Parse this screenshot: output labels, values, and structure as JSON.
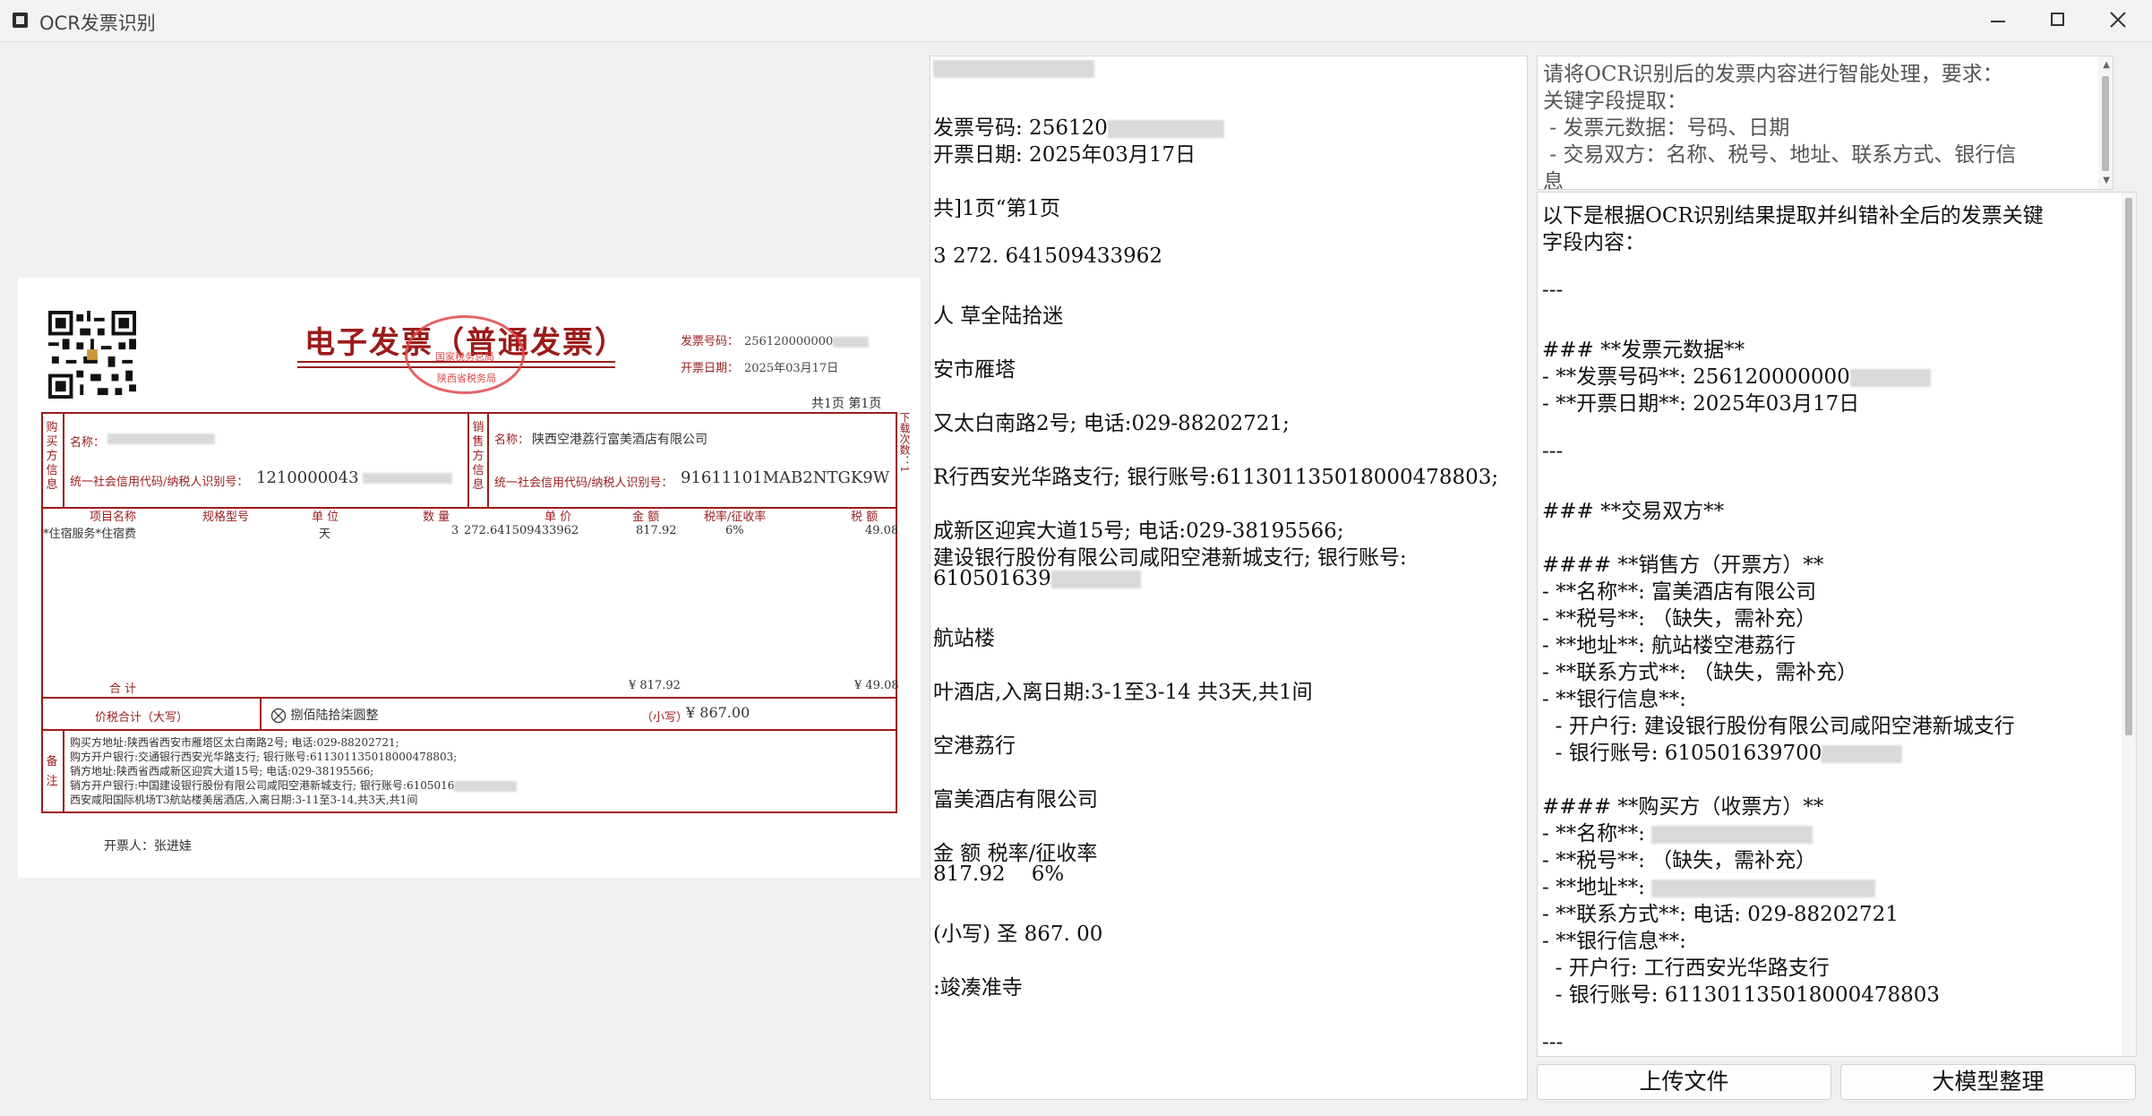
{
  "window": {
    "title": "OCR发票识别",
    "min_icon": "minimize-icon",
    "max_icon": "maximize-icon",
    "close_icon": "close-icon"
  },
  "invoice": {
    "title": "电子发票（普通发票）",
    "seal_top": "国家税务总局",
    "seal_bottom": "陕西省税务局",
    "invoice_no_label": "发票号码：",
    "invoice_no": "256120000000",
    "date_label": "开票日期：",
    "date": "2025年03月17日",
    "pages": "共1页    第1页",
    "side_note": "下载次数：1",
    "buyer_vlabel": "购买方信息",
    "seller_vlabel": "销售方信息",
    "name_label": "名称：",
    "buyer_name": "",
    "seller_name": "陕西空港荔行富美酒店有限公司",
    "tax_label": "统一社会信用代码/纳税人识别号：",
    "buyer_tax": "1210000043",
    "seller_tax": "91611101MAB2NTGK9W",
    "columns": [
      "项目名称",
      "规格型号",
      "单  位",
      "数  量",
      "单  价",
      "金  额",
      "税率/征收率",
      "税  额"
    ],
    "item": {
      "name": "*住宿服务*住宿费",
      "spec": "",
      "unit": "天",
      "qty": "3",
      "price": "272.641509433962",
      "amount": "817.92",
      "rate": "6%",
      "tax": "49.08"
    },
    "total_label": "合        计",
    "total_amount": "¥ 817.92",
    "total_tax": "¥ 49.08",
    "price_tax_label": "价税合计（大写）",
    "amount_words": "捌佰陆拾柒圆整",
    "small_label": "（小写）",
    "amount_small": "¥  867.00",
    "remark_vlabel": "备注",
    "remarks": [
      "购买方地址:陕西省西安市雁塔区太白南路2号;  电话:029-88202721;",
      "购方开户银行:交通银行西安光华路支行;  银行账号:611301135018000478803;",
      "销方地址:陕西省西咸新区迎宾大道15号;  电话:029-38195566;",
      "销方开户银行:中国建设银行股份有限公司咸阳空港新城支行;  银行账号:6105016",
      "西安咸阳国际机场T3航站楼美居酒店,入离日期:3-11至3-14,共3天,共1间"
    ],
    "drawer": "开票人：张进娃"
  },
  "ocr_text": [
    "",
    "发票号码: 256120",
    "开票日期: 2025年03月17日",
    "",
    "共]1页“第1页",
    "",
    "3 272. 641509433962",
    "",
    "人 草全陆拾迷",
    "",
    "安市雁塔",
    "",
    "又太白南路2号; 电话:029-88202721;",
    "",
    "R行西安光华路支行; 银行账号:611301135018000478803;",
    "",
    "成新区迎宾大道15号; 电话:029-38195566;",
    "建设银行股份有限公司咸阳空港新城支行; 银行账号:",
    "610501639",
    "",
    "航站楼",
    "",
    "叶酒店,入离日期:3-1至3-14 共3天,共1间",
    "",
    "空港荔行",
    "",
    "富美酒店有限公司",
    "",
    "金 额 税率/征收率",
    "817.92    6%",
    "",
    "(小写) 圣 867. 00",
    "",
    ":竣凑准寺"
  ],
  "prompt_text": [
    "请将OCR识别后的发票内容进行智能处理，要求：",
    "关键字段提取：",
    " - 发票元数据：号码、日期",
    " - 交易双方：名称、税号、地址、联系方式、银行信",
    "息"
  ],
  "result_text": [
    "以下是根据OCR识别结果提取并纠错补全后的发票关键",
    "字段内容：",
    "",
    "---",
    "",
    "### **发票元数据**",
    "- **发票号码**: 256120000000",
    "- **开票日期**: 2025年03月17日",
    "",
    "---",
    "",
    "### **交易双方**",
    "",
    "#### **销售方（开票方）**",
    "- **名称**: 富美酒店有限公司",
    "- **税号**: （缺失，需补充）",
    "- **地址**: 航站楼空港荔行",
    "- **联系方式**: （缺失，需补充）",
    "- **银行信息**:",
    "  - 开户行: 建设银行股份有限公司咸阳空港新城支行",
    "  - 银行账号: 610501639700",
    "",
    "#### **购买方（收票方）**",
    "- **名称**: ",
    "- **税号**: （缺失，需补充）",
    "- **地址**: ",
    "- **联系方式**: 电话: 029-88202721",
    "- **银行信息**:",
    "  - 开户行: 工行西安光华路支行",
    "  - 银行账号: 611301135018000478803",
    "",
    "---"
  ],
  "buttons": {
    "upload": "上传文件",
    "llm": "大模型整理"
  }
}
